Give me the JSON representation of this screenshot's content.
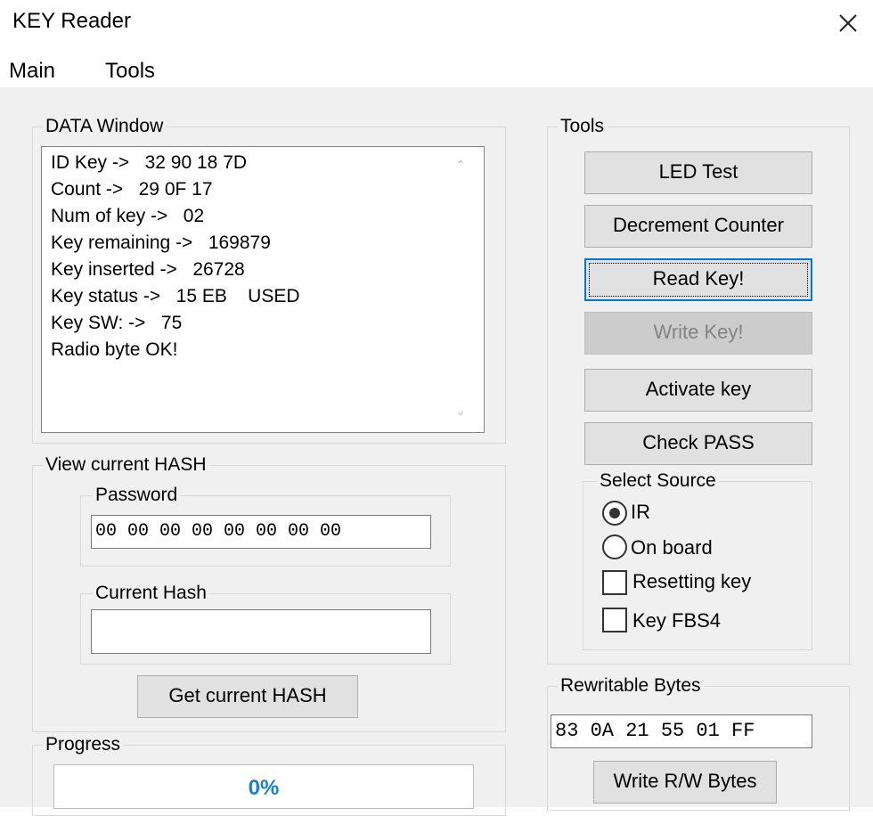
{
  "window": {
    "title": "KEY Reader"
  },
  "menu": {
    "items": [
      "Main",
      "Tools"
    ]
  },
  "data_window": {
    "label": "DATA Window",
    "lines": [
      "ID Key ->   32 90 18 7D",
      "Count ->   29 0F 17",
      "Num of key ->   02",
      "Key remaining ->   169879",
      "Key inserted ->   26728",
      "Key status ->   15 EB    USED",
      "Key SW: ->   75",
      "Radio byte OK!"
    ]
  },
  "hash_panel": {
    "label": "View current HASH",
    "password_label": "Password",
    "password_value": "00 00 00 00 00 00 00 00",
    "current_hash_label": "Current Hash",
    "current_hash_value": "",
    "get_button": "Get current HASH"
  },
  "progress": {
    "label": "Progress",
    "value": 0,
    "text": "0%"
  },
  "tools": {
    "label": "Tools",
    "buttons": {
      "led_test": "LED Test",
      "decrement": "Decrement Counter",
      "read_key": "Read Key!",
      "write_key": "Write Key!",
      "activate": "Activate key",
      "check_pass": "Check PASS"
    },
    "select_source": {
      "label": "Select Source",
      "ir": "IR",
      "onboard": "On board",
      "resetting": "Resetting key",
      "fbs4": "Key FBS4",
      "selected": "IR"
    }
  },
  "rewritable": {
    "label": "Rewritable Bytes",
    "value": "83 0A 21 55 01 FF",
    "button": "Write R/W Bytes"
  }
}
